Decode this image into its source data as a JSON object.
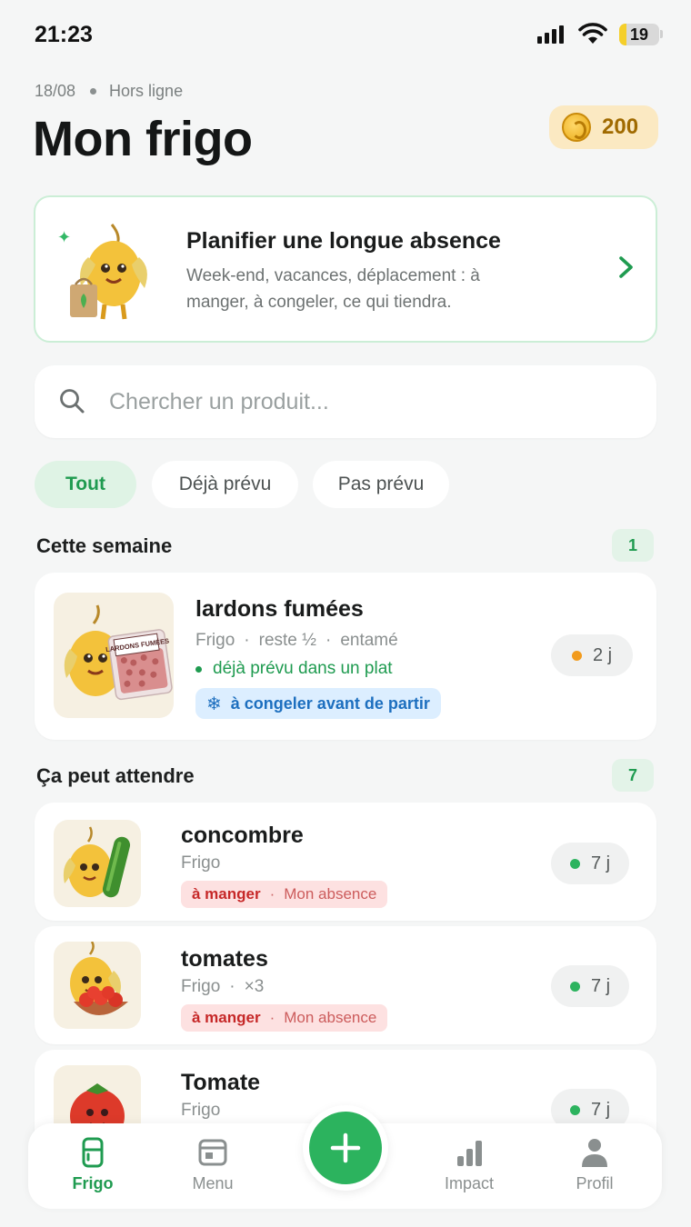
{
  "status_bar": {
    "time": "21:23",
    "battery": "19"
  },
  "header": {
    "date": "18/08",
    "connection": "Hors ligne",
    "title": "Mon frigo",
    "coins": "200"
  },
  "banner": {
    "title": "Planifier une longue absence",
    "description": "Week-end, vacances, déplacement : à manger, à congeler, ce qui tiendra."
  },
  "search": {
    "placeholder": "Chercher un produit..."
  },
  "filters": [
    "Tout",
    "Déjà prévu",
    "Pas prévu"
  ],
  "sections": [
    {
      "title": "Cette semaine",
      "count": "1",
      "items": [
        {
          "name": "lardons fumées",
          "meta": [
            "Frigo",
            "reste ½",
            "entamé"
          ],
          "planned": "déjà prévu dans un plat",
          "tag": "à congeler avant de partir",
          "package_label": "LARDONS FUMÉES",
          "days": "2 j",
          "status_color": "#f29b1d"
        }
      ]
    },
    {
      "title": "Ça peut attendre",
      "count": "7",
      "items": [
        {
          "name": "concombre",
          "meta": [
            "Frigo"
          ],
          "tag_eat": "à manger",
          "tag_absence": "Mon absence",
          "days": "7 j",
          "status_color": "#2cb35e"
        },
        {
          "name": "tomates",
          "meta": [
            "Frigo",
            "×3"
          ],
          "tag_eat": "à manger",
          "tag_absence": "Mon absence",
          "days": "7 j",
          "status_color": "#2cb35e"
        },
        {
          "name": "Tomate",
          "meta": [
            "Frigo"
          ],
          "days": "7 j",
          "status_color": "#2cb35e"
        }
      ]
    }
  ],
  "nav": {
    "items": [
      "Frigo",
      "Menu",
      "Impact",
      "Profil"
    ],
    "active": "Frigo"
  },
  "colors": {
    "accent": "#2cb35e",
    "danger": "#c62828",
    "info": "#1d6fbf",
    "coin": "#a06a00"
  },
  "icons": [
    "search-icon",
    "chevron-right-icon",
    "coin-icon",
    "snowflake-icon",
    "fridge-icon",
    "menu-icon",
    "chart-icon",
    "user-icon",
    "plus-icon"
  ]
}
